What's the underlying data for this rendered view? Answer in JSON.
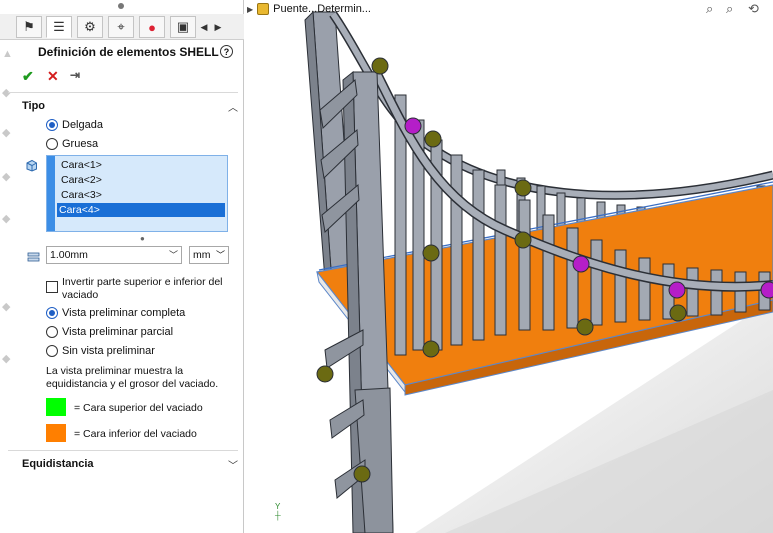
{
  "panel": {
    "title": "Definición de elementos SHELL",
    "tabs": [
      "feature-manager",
      "property-manager",
      "configuration-manager",
      "dimxpert",
      "display-manager",
      "more"
    ],
    "sections": {
      "tipo": {
        "label": "Tipo",
        "options": [
          "Delgada",
          "Gruesa"
        ],
        "selected": "Delgada"
      },
      "faces": {
        "items": [
          "Cara<1>",
          "Cara<2>",
          "Cara<3>",
          "Cara<4>"
        ],
        "selected_index": 3
      },
      "thickness": {
        "value": "1.00mm",
        "unit": "mm"
      },
      "flip_label": "Invertir parte superior e inferior del vaciado",
      "flip_checked": false,
      "preview_options": [
        "Vista preliminar completa",
        "Vista preliminar parcial",
        "Sin vista preliminar"
      ],
      "preview_selected": "Vista preliminar completa",
      "note": "La vista preliminar muestra la equidistancia y el grosor del vaciado.",
      "legend": [
        {
          "color": "#00ff00",
          "label": "= Cara superior del vaciado"
        },
        {
          "color": "#ff7f00",
          "label": "= Cara inferior del vaciado"
        }
      ],
      "equidistancia": {
        "label": "Equidistancia"
      }
    }
  },
  "viewport": {
    "tree_label": "Puente...Determin...",
    "triad_label": "Y"
  },
  "colors": {
    "deck": "#f07f0e",
    "structure": "#9aa0ab",
    "node_green": "#6b6a12",
    "node_magenta": "#b51ec8",
    "selection": "#1a6fd6"
  }
}
